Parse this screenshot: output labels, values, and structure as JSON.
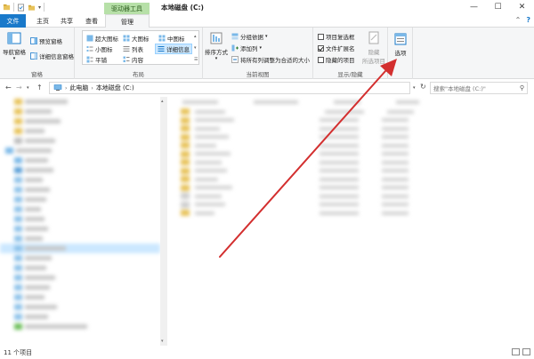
{
  "window": {
    "context_tab": "驱动器工具",
    "title": "本地磁盘 (C:)",
    "minimize": "—",
    "maximize": "☐",
    "close": "✕"
  },
  "tabs": {
    "file": "文件",
    "home": "主页",
    "share": "共享",
    "view": "查看",
    "manage": "管理"
  },
  "ribbon": {
    "panes": {
      "label": "窗格",
      "nav_pane": "导航窗格",
      "preview_pane": "预览窗格",
      "details_pane": "详细信息窗格"
    },
    "layout": {
      "label": "布局",
      "extra_large_icons": "超大图标",
      "large_icons": "大图标",
      "medium_icons": "中图标",
      "small_icons": "小图标",
      "list": "列表",
      "details": "详细信息",
      "tiles": "平铺",
      "content": "内容"
    },
    "current_view": {
      "label": "当前视图",
      "sort_by": "排序方式",
      "group_by": "分组依据",
      "add_columns": "添加列",
      "size_all_columns": "将所有列调整为合适的大小"
    },
    "show_hide": {
      "label": "显示/隐藏",
      "item_checkboxes": "项目复选框",
      "file_extensions": "文件扩展名",
      "hidden_items": "隐藏的项目",
      "hide_selected_line1": "隐藏",
      "hide_selected_line2": "所选项目"
    },
    "options": "选项"
  },
  "address": {
    "crumb_root": "此电脑",
    "crumb_drive": "本地磁盘 (C:)",
    "search_placeholder": "搜索\"本地磁盘 (C:)\""
  },
  "status": {
    "item_count": "11 个项目"
  },
  "colors": {
    "file_tab": "#1979ca",
    "context_tab": "#b7e0a8",
    "arrow": "#d32f2f",
    "selection": "#cce8ff"
  }
}
